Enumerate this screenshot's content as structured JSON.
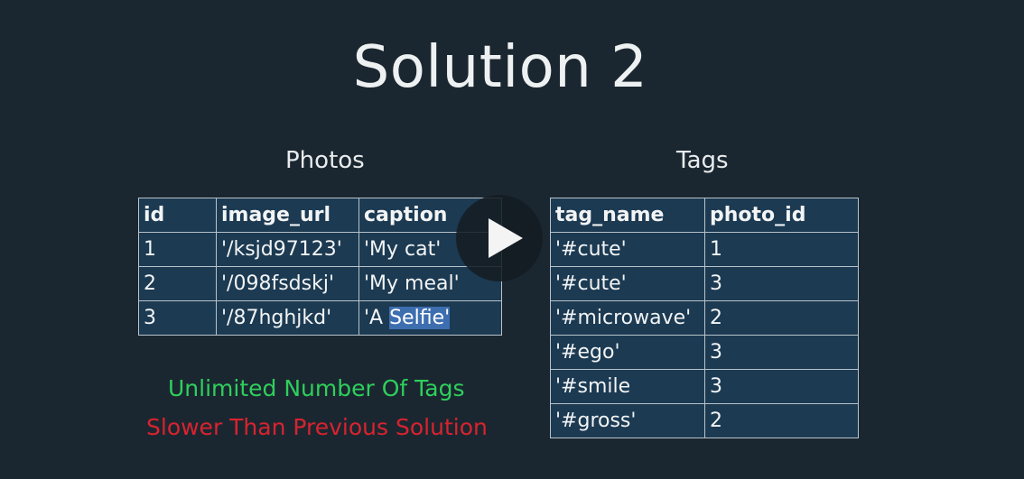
{
  "slide": {
    "title": "Solution 2"
  },
  "photos": {
    "heading": "Photos",
    "columns": [
      "id",
      "image_url",
      "caption"
    ],
    "rows": [
      [
        "1",
        "'/ksjd97123'",
        "'My cat'"
      ],
      [
        "2",
        "'/098fsdskj'",
        "'My meal'"
      ],
      [
        "3",
        "'/87hghjkd'",
        "'A ",
        "Selfie'"
      ]
    ]
  },
  "tags": {
    "heading": "Tags",
    "columns": [
      "tag_name",
      "photo_id"
    ],
    "rows": [
      [
        "'#cute'",
        "1"
      ],
      [
        "'#cute'",
        "3"
      ],
      [
        "'#microwave'",
        "2"
      ],
      [
        "'#ego'",
        "3"
      ],
      [
        "'#smile",
        "3"
      ],
      [
        "'#gross'",
        "2"
      ]
    ]
  },
  "notes": {
    "pro": "Unlimited Number Of Tags",
    "con": "Slower Than Previous Solution"
  },
  "colors": {
    "background": "#1b2730",
    "cell_fill": "#1c3a52",
    "pro_text": "#2ecf5c",
    "con_text": "#d8232f",
    "selection": "#3d6eb0"
  },
  "player": {
    "icon": "play-icon"
  }
}
